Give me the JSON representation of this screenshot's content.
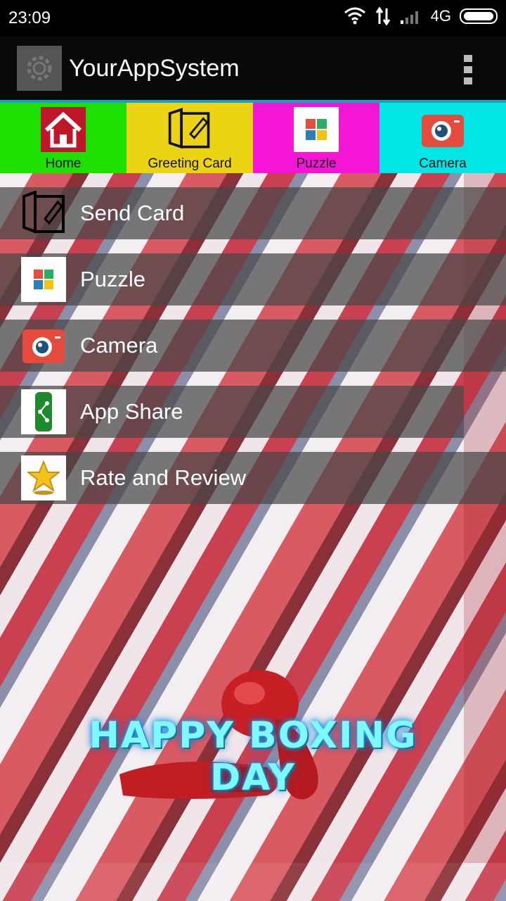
{
  "status_bar": {
    "time": "23:09",
    "network": "4G"
  },
  "app_bar": {
    "title": "YourAppSystem"
  },
  "tabs": [
    {
      "label": "Home",
      "color": "#1de000"
    },
    {
      "label": "Greeting Card",
      "color": "#ecd415"
    },
    {
      "label": "Puzzle",
      "color": "#f515d5"
    },
    {
      "label": "Camera",
      "color": "#00e5e5"
    }
  ],
  "menu": [
    {
      "label": "Send Card",
      "icon": "edit-card-icon"
    },
    {
      "label": "Puzzle",
      "icon": "puzzle-icon"
    },
    {
      "label": "Camera",
      "icon": "camera-icon"
    },
    {
      "label": "App Share",
      "icon": "share-icon"
    },
    {
      "label": "Rate and Review",
      "icon": "star-trophy-icon"
    }
  ],
  "banner": {
    "text": "HAPPY BOXING DAY"
  }
}
